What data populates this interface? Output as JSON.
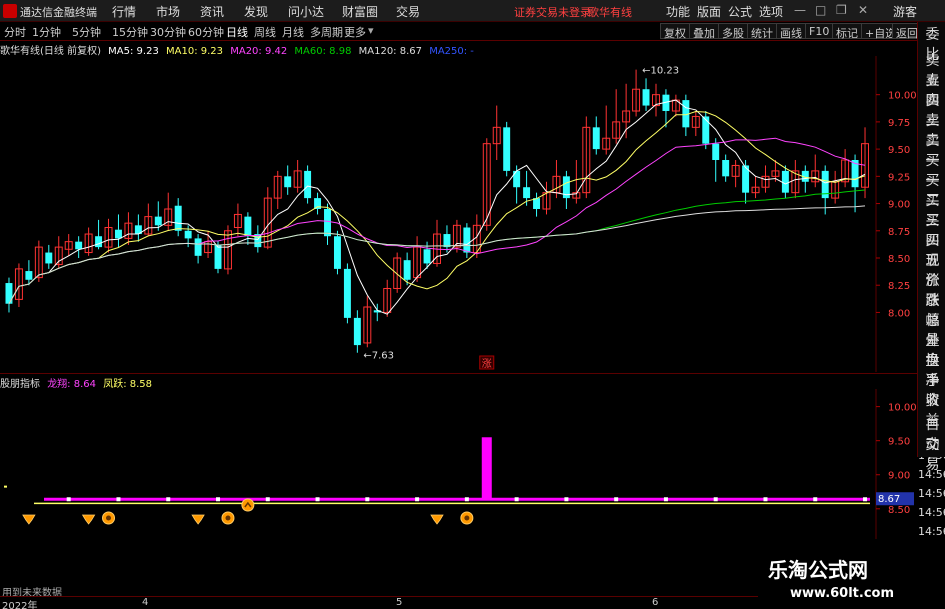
{
  "app": {
    "name": "通达信金融终端",
    "status": "证券交易未登录",
    "stock_name": "歌华有线",
    "user": "游客"
  },
  "menus": [
    "行情",
    "市场",
    "资讯",
    "发现",
    "问小达",
    "财富圈",
    "交易"
  ],
  "right_menus": [
    "功能",
    "版面",
    "公式",
    "选项"
  ],
  "periods": [
    "分时",
    "1分钟",
    "5分钟",
    "15分钟",
    "30分钟",
    "60分钟",
    "日线",
    "周线",
    "月线",
    "多周期",
    "更多"
  ],
  "active_period": "日线",
  "toolbar_right": [
    "复权",
    "叠加",
    "多股",
    "统计",
    "画线",
    "F10",
    "标记",
    "+自选",
    "返回"
  ],
  "colors": {
    "up": "#ff3333",
    "down": "#33ffff",
    "ma5": "#ffffff",
    "ma10": "#ffff66",
    "ma20": "#ff44ff",
    "ma60": "#00cc00",
    "ma120": "#dddddd",
    "ma250": "#3355ff",
    "accent": "#ff00ff"
  },
  "main_info": {
    "title": "歌华有线(日线 前复权)",
    "ma5": "MA5: 9.23",
    "ma10": "MA10: 9.23",
    "ma20": "MA20: 9.42",
    "ma60": "MA60: 8.98",
    "ma120": "MA120: 8.67",
    "ma250": "MA250: -"
  },
  "sub_info": {
    "name": "股朋指标",
    "longxiang": "龙翔: 8.64",
    "fengyue": "凤跃: 8.58"
  },
  "sidebar_labels": [
    "委比",
    "卖五",
    "卖四",
    "卖三",
    "卖二",
    "卖一",
    "买一",
    "买二",
    "买三",
    "买四",
    "买五",
    "现价",
    "涨跌",
    "涨幅",
    "总量",
    "外盘",
    "换手",
    "净资",
    "收益",
    "自动",
    "交易"
  ],
  "warning": "用到未来数据",
  "watermark": {
    "title": "乐淘公式网",
    "url": "www.60lt.com"
  },
  "sidebar_times": [
    "14:56",
    "14:56",
    "14:56",
    "14:56",
    "14:56",
    "14:56",
    "14:56"
  ],
  "sidebar_badge": "8.67",
  "chart_data": {
    "type": "candlestick",
    "y_range": [
      7.6,
      10.3
    ],
    "y_ticks": [
      "10.00",
      "9.75",
      "9.50",
      "9.25",
      "9.00",
      "8.75",
      "8.50",
      "8.25",
      "8.00"
    ],
    "time_labels": [
      "2022年",
      "4",
      "5",
      "6"
    ],
    "high_label": "10.23",
    "low_label": "7.63",
    "marker_label": "涨",
    "candles": [
      [
        8.27,
        8.08,
        8.32,
        8.0
      ],
      [
        8.12,
        8.4,
        8.45,
        8.05
      ],
      [
        8.38,
        8.3,
        8.48,
        8.25
      ],
      [
        8.32,
        8.6,
        8.66,
        8.28
      ],
      [
        8.55,
        8.45,
        8.62,
        8.4
      ],
      [
        8.44,
        8.6,
        8.7,
        8.4
      ],
      [
        8.58,
        8.65,
        8.72,
        8.52
      ],
      [
        8.65,
        8.58,
        8.7,
        8.5
      ],
      [
        8.55,
        8.72,
        8.78,
        8.52
      ],
      [
        8.7,
        8.6,
        8.85,
        8.58
      ],
      [
        8.6,
        8.78,
        8.86,
        8.55
      ],
      [
        8.76,
        8.68,
        8.9,
        8.6
      ],
      [
        8.68,
        8.82,
        8.92,
        8.62
      ],
      [
        8.8,
        8.72,
        8.9,
        8.65
      ],
      [
        8.72,
        8.88,
        9.0,
        8.7
      ],
      [
        8.88,
        8.8,
        9.02,
        8.75
      ],
      [
        8.8,
        8.95,
        9.1,
        8.75
      ],
      [
        8.98,
        8.75,
        9.05,
        8.7
      ],
      [
        8.75,
        8.68,
        8.8,
        8.6
      ],
      [
        8.68,
        8.52,
        8.72,
        8.45
      ],
      [
        8.55,
        8.65,
        8.75,
        8.5
      ],
      [
        8.62,
        8.4,
        8.66,
        8.36
      ],
      [
        8.4,
        8.75,
        8.8,
        8.35
      ],
      [
        8.78,
        8.9,
        9.0,
        8.7
      ],
      [
        8.88,
        8.7,
        8.92,
        8.62
      ],
      [
        8.72,
        8.6,
        8.8,
        8.55
      ],
      [
        8.6,
        9.05,
        9.15,
        8.58
      ],
      [
        9.05,
        9.25,
        9.3,
        8.95
      ],
      [
        9.25,
        9.15,
        9.35,
        9.08
      ],
      [
        9.15,
        9.3,
        9.4,
        9.1
      ],
      [
        9.3,
        9.05,
        9.35,
        9.0
      ],
      [
        9.05,
        8.95,
        9.1,
        8.9
      ],
      [
        8.95,
        8.7,
        9.0,
        8.62
      ],
      [
        8.7,
        8.4,
        8.75,
        8.35
      ],
      [
        8.4,
        7.95,
        8.45,
        7.9
      ],
      [
        7.95,
        7.7,
        8.02,
        7.63
      ],
      [
        7.72,
        8.05,
        8.15,
        7.68
      ],
      [
        8.02,
        8.0,
        8.08,
        7.92
      ],
      [
        8.0,
        8.22,
        8.3,
        7.96
      ],
      [
        8.22,
        8.5,
        8.55,
        8.18
      ],
      [
        8.48,
        8.3,
        8.55,
        8.25
      ],
      [
        8.32,
        8.6,
        8.7,
        8.28
      ],
      [
        8.58,
        8.45,
        8.65,
        8.4
      ],
      [
        8.45,
        8.72,
        8.85,
        8.42
      ],
      [
        8.72,
        8.6,
        8.8,
        8.55
      ],
      [
        8.6,
        8.8,
        8.85,
        8.55
      ],
      [
        8.78,
        8.55,
        8.82,
        8.5
      ],
      [
        8.55,
        8.8,
        8.9,
        8.5
      ],
      [
        8.8,
        9.55,
        9.6,
        8.75
      ],
      [
        9.55,
        9.7,
        9.9,
        9.4
      ],
      [
        9.7,
        9.3,
        9.75,
        9.25
      ],
      [
        9.3,
        9.15,
        9.35,
        9.0
      ],
      [
        9.15,
        9.05,
        9.3,
        8.98
      ],
      [
        9.05,
        8.95,
        9.1,
        8.88
      ],
      [
        8.95,
        9.1,
        9.2,
        8.9
      ],
      [
        9.1,
        9.25,
        9.4,
        9.05
      ],
      [
        9.25,
        9.05,
        9.3,
        8.95
      ],
      [
        9.05,
        9.1,
        9.4,
        9.0
      ],
      [
        9.1,
        9.7,
        9.8,
        9.05
      ],
      [
        9.7,
        9.5,
        9.8,
        9.45
      ],
      [
        9.5,
        9.6,
        9.9,
        9.45
      ],
      [
        9.6,
        9.75,
        10.05,
        9.55
      ],
      [
        9.75,
        9.85,
        10.1,
        9.6
      ],
      [
        9.85,
        10.05,
        10.23,
        9.8
      ],
      [
        10.05,
        9.9,
        10.15,
        9.85
      ],
      [
        9.9,
        10.0,
        10.1,
        9.8
      ],
      [
        10.0,
        9.85,
        10.05,
        9.7
      ],
      [
        9.85,
        9.95,
        10.0,
        9.8
      ],
      [
        9.95,
        9.7,
        10.0,
        9.62
      ],
      [
        9.7,
        9.8,
        9.85,
        9.62
      ],
      [
        9.8,
        9.55,
        9.85,
        9.5
      ],
      [
        9.55,
        9.4,
        9.6,
        9.2
      ],
      [
        9.4,
        9.25,
        9.45,
        9.2
      ],
      [
        9.25,
        9.35,
        9.4,
        9.15
      ],
      [
        9.35,
        9.1,
        9.4,
        9.0
      ],
      [
        9.1,
        9.15,
        9.25,
        9.05
      ],
      [
        9.15,
        9.25,
        9.35,
        9.1
      ],
      [
        9.25,
        9.3,
        9.4,
        9.2
      ],
      [
        9.3,
        9.1,
        9.35,
        9.05
      ],
      [
        9.1,
        9.3,
        9.4,
        9.05
      ],
      [
        9.3,
        9.2,
        9.35,
        9.1
      ],
      [
        9.2,
        9.3,
        9.45,
        9.15
      ],
      [
        9.3,
        9.05,
        9.35,
        8.9
      ],
      [
        9.05,
        9.2,
        9.3,
        9.0
      ],
      [
        9.2,
        9.4,
        9.5,
        9.15
      ],
      [
        9.4,
        9.15,
        9.45,
        8.92
      ],
      [
        9.15,
        9.55,
        9.7,
        9.05
      ]
    ],
    "sub_y_range": [
      8.35,
      10.2
    ],
    "sub_y_ticks": [
      "10.00",
      "9.50",
      "9.00",
      "8.50"
    ],
    "sub_bar": {
      "index": 48,
      "value": 9.55
    },
    "sub_line_magenta": 8.64,
    "sub_line_yellow": 8.58,
    "sub_icons": [
      {
        "index": 2,
        "kind": "diamond"
      },
      {
        "index": 8,
        "kind": "diamond"
      },
      {
        "index": 10,
        "kind": "coin"
      },
      {
        "index": 19,
        "kind": "diamond"
      },
      {
        "index": 22,
        "kind": "coin"
      },
      {
        "index": 24,
        "kind": "arrow"
      },
      {
        "index": 43,
        "kind": "diamond"
      },
      {
        "index": 46,
        "kind": "coin"
      }
    ]
  }
}
